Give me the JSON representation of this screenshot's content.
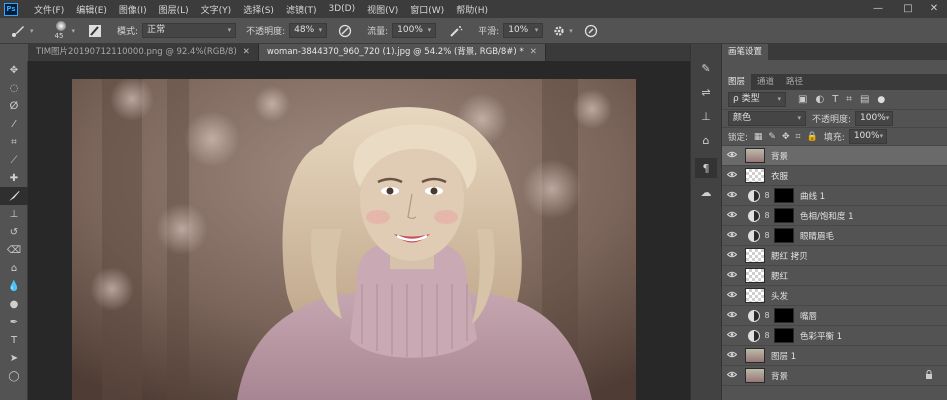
{
  "menu": {
    "app_logo": "Ps",
    "items": [
      "文件(F)",
      "编辑(E)",
      "图像(I)",
      "图层(L)",
      "文字(Y)",
      "选择(S)",
      "滤镜(T)",
      "3D(D)",
      "视图(V)",
      "窗口(W)",
      "帮助(H)"
    ],
    "window_controls": [
      "—",
      "□",
      "✕"
    ]
  },
  "options": {
    "brush_size": "45",
    "mode_label": "模式:",
    "mode_value": "正常",
    "opacity_label": "不透明度:",
    "opacity_value": "48%",
    "flow_label": "流量:",
    "flow_value": "100%",
    "smoothing_label": "平滑:",
    "smoothing_value": "10%"
  },
  "tabs": [
    {
      "label": "TIM图片20190712110000.png @ 92.4%(RGB/8)",
      "close": "✕"
    },
    {
      "label": "woman-3844370_960_720 (1).jpg @ 54.2% (背景, RGB/8#) *",
      "close": "✕"
    }
  ],
  "panel": {
    "brush_settings_tab": "画笔设置",
    "tabs": [
      "图层",
      "通道",
      "路径"
    ],
    "filter_label": "ρ 类型",
    "blend_mode": "颜色",
    "opacity_label": "不透明度:",
    "opacity_value": "100%",
    "lock_label": "锁定:",
    "fill_label": "填充:",
    "fill_value": "100%",
    "layers": [
      {
        "name": "背景",
        "thumb": "img",
        "selected": true,
        "adjust": false,
        "lock": false
      },
      {
        "name": "衣服",
        "thumb": "check",
        "selected": false,
        "adjust": false,
        "lock": false
      },
      {
        "name": "曲线 1",
        "thumb": "black",
        "selected": false,
        "adjust": true,
        "lock": false
      },
      {
        "name": "色相/饱和度 1",
        "thumb": "black",
        "selected": false,
        "adjust": true,
        "lock": false
      },
      {
        "name": "眼睛眉毛",
        "thumb": "black",
        "selected": false,
        "adjust": true,
        "lock": false
      },
      {
        "name": "腮红 拷贝",
        "thumb": "check",
        "selected": false,
        "adjust": false,
        "lock": false
      },
      {
        "name": "腮红",
        "thumb": "check",
        "selected": false,
        "adjust": false,
        "lock": false
      },
      {
        "name": "头发",
        "thumb": "check",
        "selected": false,
        "adjust": false,
        "lock": false
      },
      {
        "name": "嘴唇",
        "thumb": "black",
        "selected": false,
        "adjust": true,
        "lock": false
      },
      {
        "name": "色彩平衡 1",
        "thumb": "black",
        "selected": false,
        "adjust": true,
        "lock": false
      },
      {
        "name": "图层 1",
        "thumb": "img",
        "selected": false,
        "adjust": false,
        "lock": false
      },
      {
        "name": "背景",
        "thumb": "img",
        "selected": false,
        "adjust": false,
        "lock": true
      }
    ]
  },
  "icons": {
    "eye": "eye-icon",
    "lock": "lock-icon",
    "link": "chain-link-icon"
  }
}
